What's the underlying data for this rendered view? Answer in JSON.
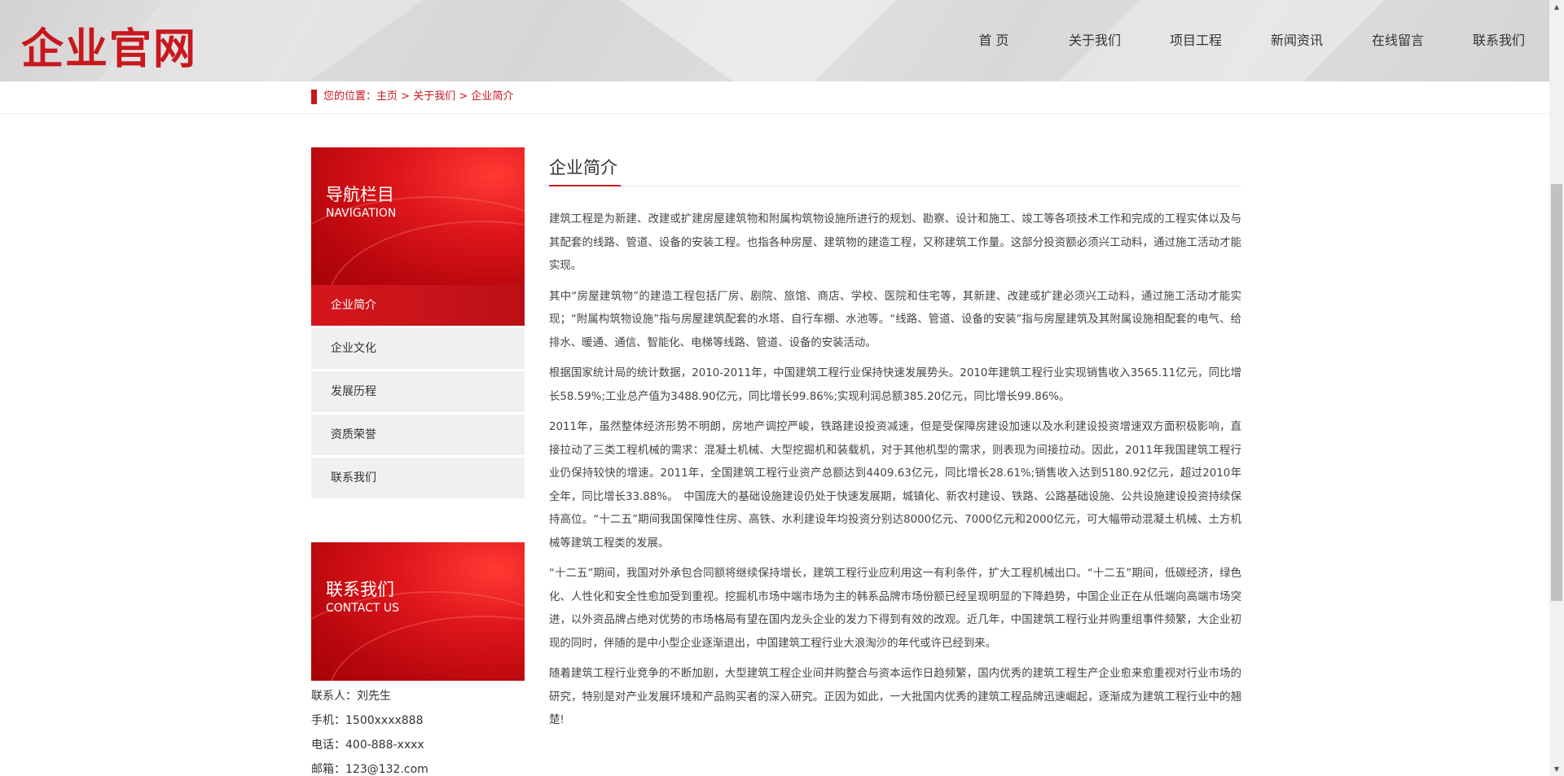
{
  "header": {
    "logo": "企业官网",
    "nav": [
      "首 页",
      "关于我们",
      "项目工程",
      "新闻资讯",
      "在线留言",
      "联系我们"
    ]
  },
  "breadcrumb": {
    "prefix": "您的位置：",
    "home": "主页",
    "sep": " > ",
    "parent": "关于我们",
    "current": "企业简介"
  },
  "sidebar": {
    "nav_title_cn": "导航栏目",
    "nav_title_en": "NAVIGATION",
    "items": [
      "企业简介",
      "企业文化",
      "发展历程",
      "资质荣誉",
      "联系我们"
    ],
    "active_index": 0,
    "contact_title_cn": "联系我们",
    "contact_title_en": "CONTACT US",
    "contact": {
      "person": "联系人：刘先生",
      "mobile": "手机：1500xxxx888",
      "phone": "电话：400-888-xxxx",
      "email": "邮箱：123@132.com"
    }
  },
  "main": {
    "title": "企业简介",
    "paragraphs": [
      "建筑工程是为新建、改建或扩建房屋建筑物和附属构筑物设施所进行的规划、勘察、设计和施工、竣工等各项技术工作和完成的工程实体以及与其配套的线路、管道、设备的安装工程。也指各种房屋、建筑物的建造工程，又称建筑工作量。这部分投资额必须兴工动料，通过施工活动才能实现。",
      "其中“房屋建筑物”的建造工程包括厂房、剧院、旅馆、商店、学校、医院和住宅等，其新建、改建或扩建必须兴工动料，通过施工活动才能实现；“附属构筑物设施”指与房屋建筑配套的水塔、自行车棚、水池等。“线路、管道、设备的安装”指与房屋建筑及其附属设施相配套的电气、给排水、暖通、通信、智能化、电梯等线路、管道、设备的安装活动。",
      "根据国家统计局的统计数据，2010-2011年，中国建筑工程行业保持快速发展势头。2010年建筑工程行业实现销售收入3565.11亿元，同比增长58.59%;工业总产值为3488.90亿元，同比增长99.86%;实现利润总额385.20亿元，同比增长99.86%。",
      "2011年，虽然整体经济形势不明朗，房地产调控严峻，铁路建设投资减速，但是受保障房建设加速以及水利建设投资增速双方面积极影响，直接拉动了三类工程机械的需求：混凝土机械、大型挖掘机和装载机，对于其他机型的需求，则表现为间接拉动。因此，2011年我国建筑工程行业仍保持较快的增速。2011年，全国建筑工程行业资产总额达到4409.63亿元，同比增长28.61%;销售收入达到5180.92亿元，超过2010年全年，同比增长33.88%。　中国庞大的基础设施建设仍处于快速发展期，城镇化、新农村建设、铁路、公路基础设施、公共设施建设投资持续保持高位。“十二五”期间我国保障性住房、高铁、水利建设年均投资分别达8000亿元、7000亿元和2000亿元，可大幅带动混凝土机械、土方机械等建筑工程类的发展。",
      "“十二五”期间，我国对外承包合同额将继续保持增长，建筑工程行业应利用这一有利条件，扩大工程机械出口。“十二五”期间，低碳经济，绿色化、人性化和安全性愈加受到重视。挖掘机市场中端市场为主的韩系品牌市场份额已经呈现明显的下降趋势，中国企业正在从低端向高端市场突进，以外资品牌占绝对优势的市场格局有望在国内龙头企业的发力下得到有效的改观。近几年，中国建筑工程行业并购重组事件频繁，大企业初现的同时，伴随的是中小型企业逐渐退出，中国建筑工程行业大浪淘沙的年代或许已经到来。",
      "随着建筑工程行业竞争的不断加剧，大型建筑工程企业间并购整合与资本运作日趋频繁，国内优秀的建筑工程生产企业愈来愈重视对行业市场的研究，特别是对产业发展环境和产品购买者的深入研究。正因为如此，一大批国内优秀的建筑工程品牌迅速崛起，逐渐成为建筑工程行业中的翘楚!"
    ]
  },
  "colors": {
    "accent": "#c9171e",
    "menu_bg": "#f0f0f0",
    "header_bg": "#dcdcdc"
  }
}
